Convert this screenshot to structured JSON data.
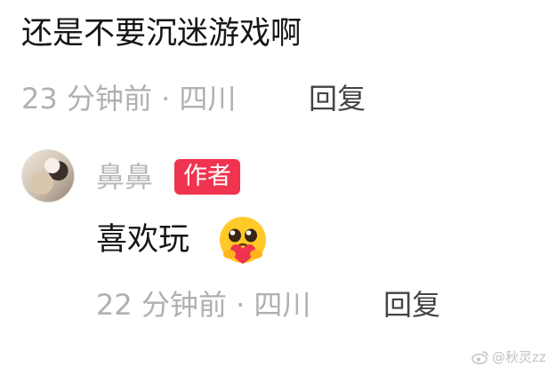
{
  "comment": {
    "text": "还是不要沉迷游戏啊",
    "meta": "23 分钟前 · 四川",
    "reply_label": "回复"
  },
  "author_reply": {
    "name": "鼻鼻",
    "badge": "作者",
    "text": "喜欢玩",
    "emoji": "heart-hug-emoji",
    "meta": "22 分钟前 · 四川",
    "reply_label": "回复"
  },
  "watermark": {
    "text": "@秋灵zz",
    "icon": "weibo-icon"
  },
  "colors": {
    "badge": "#f0334f",
    "meta": "#b0b0b0",
    "reply": "#444444"
  }
}
